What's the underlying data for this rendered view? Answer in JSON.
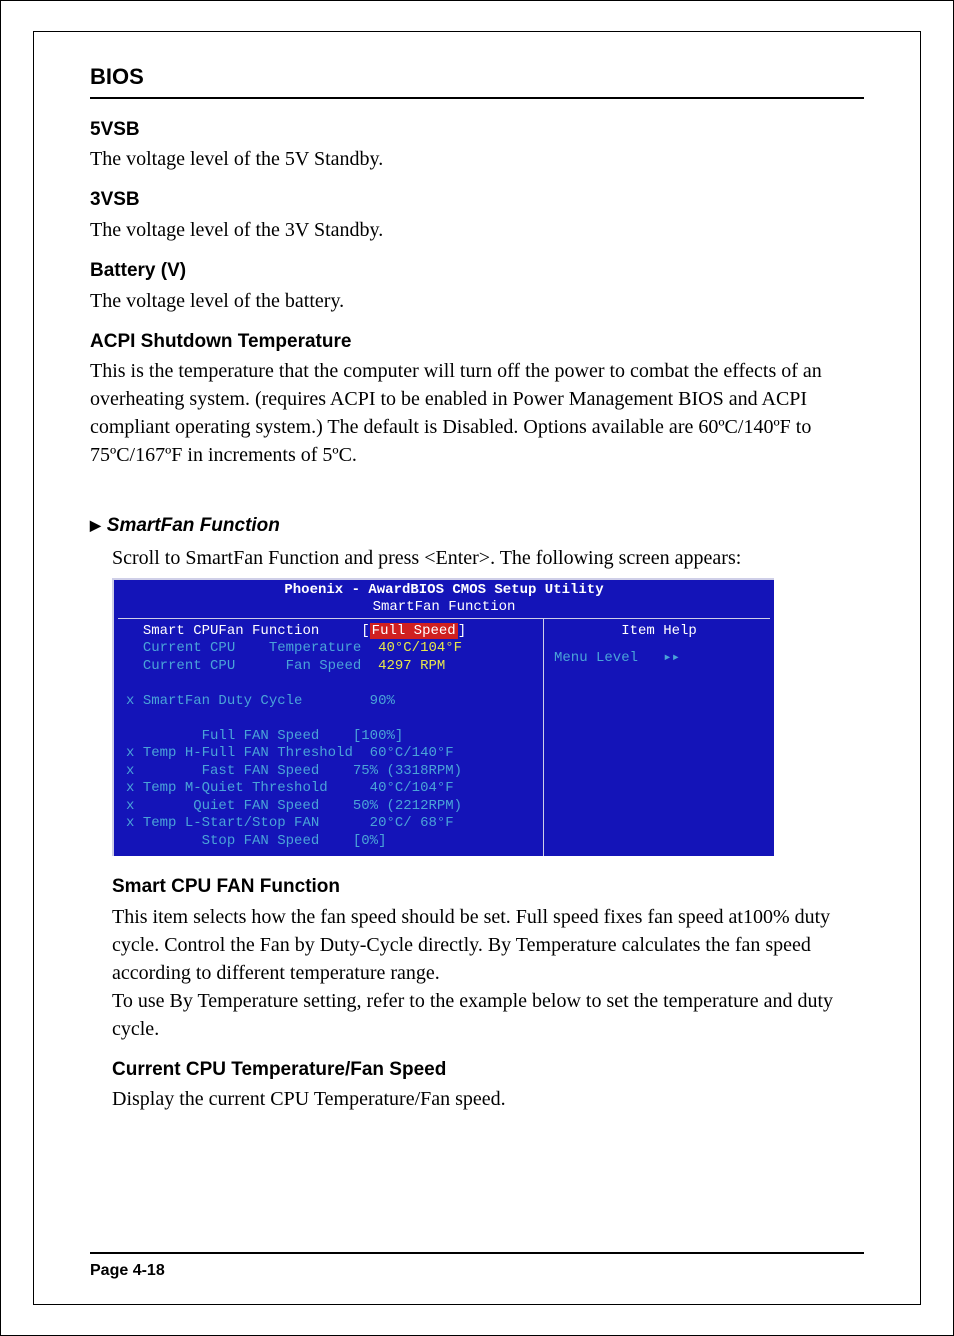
{
  "chapter_title": "BIOS",
  "items": {
    "fivevsb": {
      "head": "5VSB",
      "body": "The voltage level of the 5V Standby."
    },
    "threevsb": {
      "head": "3VSB",
      "body": "The voltage level of the 3V Standby."
    },
    "battery": {
      "head": "Battery (V)",
      "body": "The voltage level of the battery."
    },
    "acpi": {
      "head": "ACPI Shutdown Temperature",
      "body": "This is the temperature that the computer will turn off the power to combat the effects of an overheating system. (requires ACPI to be enabled in Power Management BIOS and ACPI compliant operating system.) The default is Disabled. Options available are 60ºC/140ºF to 75ºC/167ºF in increments of 5ºC."
    }
  },
  "smartfan": {
    "heading": "SmartFan Function",
    "intro": "Scroll to SmartFan Function and press <Enter>. The following screen appears:",
    "bios_title_line1": "Phoenix - AwardBIOS CMOS Setup Utility",
    "bios_title_line2": "SmartFan Function",
    "help_title": "Item Help",
    "menu_level_label": "Menu Level",
    "menu_level_marker": "▸▸",
    "rows": {
      "r1_label": "Smart CPUFan Function",
      "r1_value": "Full Speed",
      "r2_label": "Current CPU    Temperature",
      "r2_value": "40°C/104°F",
      "r3_label": "Current CPU      Fan Speed",
      "r3_value": "4297 RPM",
      "r4_label": "SmartFan Duty Cycle",
      "r4_value": "90%",
      "r5_label": "Full FAN Speed",
      "r5_value": "[100%]",
      "r6_label": "Temp H-Full FAN Threshold",
      "r6_value": "60°C/140°F",
      "r7_label": "Fast FAN Speed",
      "r7_value": "75% (3318RPM)",
      "r8_label": "Temp M-Quiet Threshold",
      "r8_value": "40°C/104°F",
      "r9_label": "Quiet FAN Speed",
      "r9_value": "50% (2212RPM)",
      "r10_label": "Temp L-Start/Stop FAN",
      "r10_value": "20°C/ 68°F",
      "r11_label": "Stop FAN Speed",
      "r11_value": "[0%]"
    },
    "cpu_fan_head": "Smart CPU FAN Function",
    "cpu_fan_body": "This item selects how the fan speed should be set. Full speed fixes fan speed at100% duty cycle. Control the Fan by Duty-Cycle directly. By Temperature calculates the fan speed according to different temperature range.\nTo use By Temperature setting, refer to the example below to set the temperature and duty cycle.",
    "cur_head": "Current CPU Temperature/Fan Speed",
    "cur_body": "Display the current CPU Temperature/Fan speed."
  },
  "page_number": "Page 4-18"
}
